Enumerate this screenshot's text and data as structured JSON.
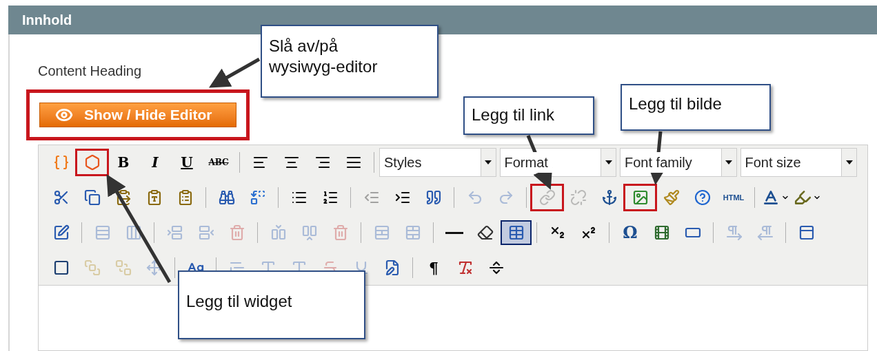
{
  "panel": {
    "title": "Innhold"
  },
  "content_heading": {
    "label": "Content Heading"
  },
  "toggle_button": {
    "label": "Show / Hide Editor",
    "marked": true
  },
  "toolbar_rows": [
    [
      {
        "kind": "icon",
        "disabled": false,
        "active": false,
        "marked": false
      },
      {
        "kind": "icon",
        "disabled": false,
        "active": false,
        "marked": true
      },
      {
        "kind": "glyph",
        "label": "B",
        "disabled": false,
        "marked": false
      },
      {
        "kind": "glyph",
        "label": "I",
        "disabled": false,
        "marked": false
      },
      {
        "kind": "glyph",
        "label": "U",
        "disabled": false,
        "marked": false
      },
      {
        "kind": "glyph",
        "label": "ABC",
        "disabled": false,
        "marked": false
      },
      {
        "kind": "sep"
      },
      {
        "kind": "icon",
        "disabled": false,
        "active": false,
        "marked": false
      },
      {
        "kind": "icon",
        "disabled": false,
        "active": false,
        "marked": false
      },
      {
        "kind": "icon",
        "disabled": false,
        "active": false,
        "marked": false
      },
      {
        "kind": "icon",
        "disabled": false,
        "active": false,
        "marked": false
      },
      {
        "kind": "sep"
      },
      {
        "kind": "select",
        "label": "Styles"
      },
      {
        "kind": "select",
        "label": "Format"
      },
      {
        "kind": "select",
        "label": "Font family"
      },
      {
        "kind": "select",
        "label": "Font size"
      }
    ],
    [
      {
        "kind": "icon",
        "disabled": false,
        "active": false,
        "marked": false
      },
      {
        "kind": "icon",
        "disabled": false,
        "active": false,
        "marked": false
      },
      {
        "kind": "icon",
        "disabled": false,
        "active": false,
        "marked": false
      },
      {
        "kind": "icon",
        "disabled": false,
        "active": false,
        "marked": false
      },
      {
        "kind": "icon",
        "disabled": false,
        "active": false,
        "marked": false
      },
      {
        "kind": "sep"
      },
      {
        "kind": "icon",
        "disabled": false,
        "active": false,
        "marked": false
      },
      {
        "kind": "icon",
        "disabled": false,
        "active": false,
        "marked": false
      },
      {
        "kind": "sep"
      },
      {
        "kind": "icon",
        "disabled": false,
        "active": false,
        "marked": false
      },
      {
        "kind": "icon",
        "disabled": false,
        "active": false,
        "marked": false
      },
      {
        "kind": "sep"
      },
      {
        "kind": "icon",
        "disabled": true,
        "active": false,
        "marked": false
      },
      {
        "kind": "icon",
        "disabled": false,
        "active": false,
        "marked": false
      },
      {
        "kind": "icon",
        "disabled": false,
        "active": false,
        "marked": false
      },
      {
        "kind": "sep"
      },
      {
        "kind": "icon",
        "disabled": true,
        "active": false,
        "marked": false
      },
      {
        "kind": "icon",
        "disabled": true,
        "active": false,
        "marked": false
      },
      {
        "kind": "sep"
      },
      {
        "kind": "icon",
        "disabled": true,
        "active": false,
        "marked": true
      },
      {
        "kind": "icon",
        "disabled": true,
        "active": false,
        "marked": false
      },
      {
        "kind": "icon",
        "disabled": false,
        "active": false,
        "marked": false
      },
      {
        "kind": "icon",
        "disabled": false,
        "active": false,
        "marked": true
      },
      {
        "kind": "icon",
        "disabled": false,
        "active": false,
        "marked": false
      },
      {
        "kind": "icon",
        "disabled": false,
        "active": false,
        "marked": false
      },
      {
        "kind": "text",
        "label": "HTML",
        "disabled": false,
        "marked": false
      },
      {
        "kind": "sep"
      },
      {
        "kind": "split",
        "disabled": false,
        "marked": false
      },
      {
        "kind": "split",
        "disabled": false,
        "marked": false
      }
    ],
    [
      {
        "kind": "icon",
        "disabled": false,
        "active": false,
        "marked": false
      },
      {
        "kind": "sep"
      },
      {
        "kind": "icon",
        "disabled": true,
        "active": false,
        "marked": false
      },
      {
        "kind": "icon",
        "disabled": true,
        "active": false,
        "marked": false
      },
      {
        "kind": "sep"
      },
      {
        "kind": "icon",
        "disabled": true,
        "active": false,
        "marked": false
      },
      {
        "kind": "icon",
        "disabled": true,
        "active": false,
        "marked": false
      },
      {
        "kind": "icon",
        "disabled": true,
        "active": false,
        "marked": false
      },
      {
        "kind": "sep"
      },
      {
        "kind": "icon",
        "disabled": true,
        "active": false,
        "marked": false
      },
      {
        "kind": "icon",
        "disabled": true,
        "active": false,
        "marked": false
      },
      {
        "kind": "icon",
        "disabled": true,
        "active": false,
        "marked": false
      },
      {
        "kind": "sep"
      },
      {
        "kind": "icon",
        "disabled": true,
        "active": false,
        "marked": false
      },
      {
        "kind": "icon",
        "disabled": true,
        "active": false,
        "marked": false
      },
      {
        "kind": "sep"
      },
      {
        "kind": "icon",
        "disabled": false,
        "active": false,
        "marked": false
      },
      {
        "kind": "icon",
        "disabled": false,
        "active": false,
        "marked": false
      },
      {
        "kind": "icon",
        "disabled": false,
        "active": true,
        "marked": false
      },
      {
        "kind": "sep"
      },
      {
        "kind": "icon",
        "disabled": false,
        "active": false,
        "marked": false
      },
      {
        "kind": "icon",
        "disabled": false,
        "active": false,
        "marked": false
      },
      {
        "kind": "sep"
      },
      {
        "kind": "glyph",
        "label": "Ω",
        "disabled": false,
        "marked": false
      },
      {
        "kind": "icon",
        "disabled": false,
        "active": false,
        "marked": false
      },
      {
        "kind": "icon",
        "disabled": false,
        "active": false,
        "marked": false
      },
      {
        "kind": "sep"
      },
      {
        "kind": "icon",
        "disabled": true,
        "active": false,
        "marked": false
      },
      {
        "kind": "icon",
        "disabled": true,
        "active": false,
        "marked": false
      },
      {
        "kind": "sep"
      },
      {
        "kind": "icon",
        "disabled": false,
        "active": false,
        "marked": false
      }
    ],
    [
      {
        "kind": "icon",
        "disabled": false,
        "active": false,
        "marked": false
      },
      {
        "kind": "icon",
        "disabled": true,
        "active": false,
        "marked": false
      },
      {
        "kind": "icon",
        "disabled": true,
        "active": false,
        "marked": false
      },
      {
        "kind": "icon",
        "disabled": true,
        "active": false,
        "marked": false
      },
      {
        "kind": "sep"
      },
      {
        "kind": "icon",
        "disabled": false,
        "active": false,
        "marked": false
      },
      {
        "kind": "sep"
      },
      {
        "kind": "icon",
        "disabled": true,
        "active": false,
        "marked": false
      },
      {
        "kind": "icon",
        "disabled": true,
        "active": false,
        "marked": false
      },
      {
        "kind": "icon",
        "disabled": true,
        "active": false,
        "marked": false
      },
      {
        "kind": "icon",
        "disabled": true,
        "active": false,
        "marked": false
      },
      {
        "kind": "icon",
        "disabled": true,
        "active": false,
        "marked": false
      },
      {
        "kind": "icon",
        "disabled": false,
        "active": false,
        "marked": false
      },
      {
        "kind": "sep"
      },
      {
        "kind": "glyph",
        "label": "¶",
        "disabled": false,
        "marked": false
      },
      {
        "kind": "icon",
        "disabled": false,
        "active": false,
        "marked": false
      },
      {
        "kind": "icon",
        "disabled": false,
        "active": false,
        "marked": false
      }
    ]
  ],
  "callouts": [
    {
      "text": "Slå av/på wysiwyg-editor"
    },
    {
      "text": "Legg til link"
    },
    {
      "text": "Legg til bilde"
    },
    {
      "text": "Legg til widget"
    }
  ]
}
